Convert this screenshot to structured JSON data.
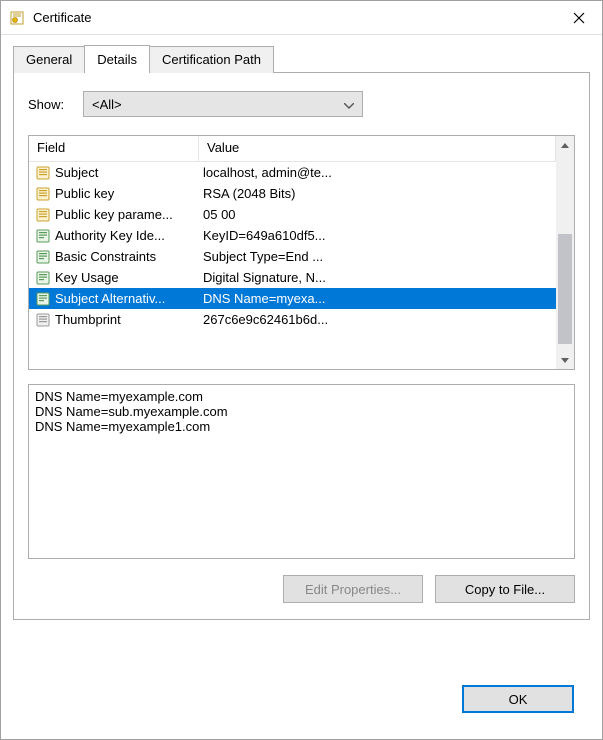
{
  "window": {
    "title": "Certificate"
  },
  "tabs": {
    "general": "General",
    "details": "Details",
    "certpath": "Certification Path",
    "active": "details"
  },
  "show": {
    "label": "Show:",
    "value": "<All>"
  },
  "columns": {
    "field": "Field",
    "value": "Value"
  },
  "rows": [
    {
      "icon": "prop",
      "field": "Subject",
      "value": "localhost, admin@te...",
      "selected": false
    },
    {
      "icon": "prop",
      "field": "Public key",
      "value": "RSA (2048 Bits)",
      "selected": false
    },
    {
      "icon": "prop",
      "field": "Public key parame...",
      "value": "05 00",
      "selected": false
    },
    {
      "icon": "ext",
      "field": "Authority Key Ide...",
      "value": "KeyID=649a610df5...",
      "selected": false
    },
    {
      "icon": "ext",
      "field": "Basic Constraints",
      "value": "Subject Type=End ...",
      "selected": false
    },
    {
      "icon": "ext",
      "field": "Key Usage",
      "value": "Digital Signature, N...",
      "selected": false
    },
    {
      "icon": "ext",
      "field": "Subject Alternativ...",
      "value": "DNS Name=myexa...",
      "selected": true
    },
    {
      "icon": "thumb",
      "field": "Thumbprint",
      "value": "267c6e9c62461b6d...",
      "selected": false
    }
  ],
  "details_text": "DNS Name=myexample.com\nDNS Name=sub.myexample.com\nDNS Name=myexample1.com",
  "buttons": {
    "edit": "Edit Properties...",
    "copy": "Copy to File...",
    "ok": "OK"
  }
}
